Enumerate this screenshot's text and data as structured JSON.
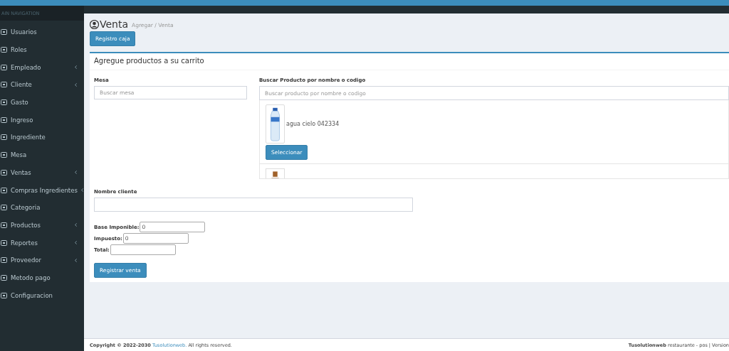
{
  "sidebar": {
    "header": "AIN NAVIGATION",
    "items": [
      {
        "label": "Usuarios",
        "has_submenu": false
      },
      {
        "label": "Roles",
        "has_submenu": false
      },
      {
        "label": "Empleado",
        "has_submenu": true
      },
      {
        "label": "Cliente",
        "has_submenu": true
      },
      {
        "label": "Gasto",
        "has_submenu": false
      },
      {
        "label": "Ingreso",
        "has_submenu": false
      },
      {
        "label": "Ingrediente",
        "has_submenu": false
      },
      {
        "label": "Mesa",
        "has_submenu": false
      },
      {
        "label": "Ventas",
        "has_submenu": true
      },
      {
        "label": "Compras Ingredientes",
        "has_submenu": true
      },
      {
        "label": "Categoria",
        "has_submenu": false
      },
      {
        "label": "Productos",
        "has_submenu": true
      },
      {
        "label": "Reportes",
        "has_submenu": true
      },
      {
        "label": "Proveedor",
        "has_submenu": true
      },
      {
        "label": "Metodo pago",
        "has_submenu": false
      },
      {
        "label": "Configuracion",
        "has_submenu": false
      }
    ]
  },
  "page": {
    "title": "Venta",
    "breadcrumb": "Agregar / Venta",
    "action_button": "Registro caja"
  },
  "box": {
    "title": "Agregue productos a su carrito",
    "mesa": {
      "label": "Mesa",
      "placeholder": "Buscar mesa"
    },
    "product_search": {
      "label": "Buscar Producto por nombre o codigo",
      "placeholder": "Buscar producto por nombre o codigo"
    },
    "products": [
      {
        "name": "agua cielo 042334",
        "button": "Seleccionar"
      }
    ],
    "cliente": {
      "label": "Nombre cliente"
    },
    "totals": [
      {
        "label": "Base Imponible:",
        "value": "0"
      },
      {
        "label": "Impuesto:",
        "value": "0"
      },
      {
        "label": "Total:"
      }
    ],
    "submit": "Registrar venta"
  },
  "footer": {
    "left_prefix": "Copyright © 2022-2030",
    "left_link": "Tusolutionweb.",
    "left_suffix": "All rights reserved.",
    "right_brand": "Tusolutionweb",
    "right_text": "restaurante - pos | Version"
  }
}
